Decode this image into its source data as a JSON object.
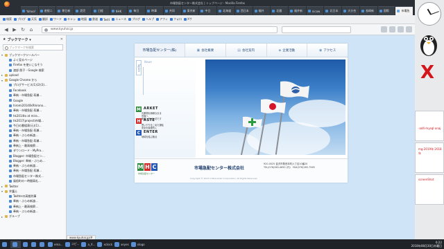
{
  "window": {
    "title": "市場急配センター株式会社 | トップページ - Mozilla Firefox"
  },
  "tabs": [
    {
      "label": "Yahoo!"
    },
    {
      "label": "産経ニ"
    },
    {
      "label": "朝日新"
    },
    {
      "label": "読売"
    },
    {
      "label": "日経"
    },
    {
      "label": "NHK"
    },
    {
      "label": "毎日"
    },
    {
      "label": "時事"
    },
    {
      "label": "共同"
    },
    {
      "label": "東京新"
    },
    {
      "label": "中日"
    },
    {
      "label": "北海道"
    },
    {
      "label": "西日本"
    },
    {
      "label": "福井"
    },
    {
      "label": "北國"
    },
    {
      "label": "福井新"
    },
    {
      "label": "nicow"
    },
    {
      "label": "北日本"
    },
    {
      "label": "大分合"
    },
    {
      "label": "長崎新"
    },
    {
      "label": "国際"
    },
    {
      "label": "市場急"
    }
  ],
  "active_tab_index": 21,
  "bookmarks_bar": [
    "検索",
    "ブログ",
    "天気",
    "翻訳",
    "ワード",
    "キャッ",
    "地図",
    "鉄道",
    "Twitt",
    "ニュース",
    "ブログ",
    "ヘルプ",
    "アフィ",
    "フォロ",
    "Xサ"
  ],
  "navbar": {
    "url": "www.kyuhai.jp",
    "back_icon": "back-arrow-icon",
    "forward_icon": "forward-arrow-icon",
    "reload_icon": "reload-icon",
    "home_icon": "home-icon"
  },
  "sidebar": {
    "title": "ブックマーク ▾",
    "close": "✕",
    "search_placeholder": "ブックマークを検索",
    "items": [
      {
        "indent": 0,
        "twisty": "▾",
        "folder": true,
        "label": "ブックマークツールバー"
      },
      {
        "indent": 1,
        "twisty": "",
        "folder": false,
        "label": "よく見るページ"
      },
      {
        "indent": 1,
        "twisty": "",
        "folder": false,
        "label": "Firefox を使いこなそう"
      },
      {
        "indent": 1,
        "twisty": "",
        "folder": false,
        "label": "渡部 朋子 - Google 検索"
      },
      {
        "indent": 0,
        "twisty": "▸",
        "folder": true,
        "label": "upload"
      },
      {
        "indent": 0,
        "twisty": "▾",
        "folder": true,
        "label": "Google Chrome から"
      },
      {
        "indent": 1,
        "twisty": "",
        "folder": false,
        "label": "プログサービス(1)(2)(3)..."
      },
      {
        "indent": 1,
        "twisty": "",
        "folder": false,
        "label": "Facebook"
      },
      {
        "indent": 1,
        "twisty": "",
        "folder": false,
        "label": "奉納・市場急配 寿瀬..."
      },
      {
        "indent": 1,
        "twisty": "",
        "folder": false,
        "label": "Google"
      },
      {
        "indent": 1,
        "twisty": "",
        "folder": false,
        "label": "hiromi20140kRhirono..."
      },
      {
        "indent": 1,
        "twisty": "",
        "folder": false,
        "label": "奉納・市場急配 寿瀬..."
      },
      {
        "indent": 1,
        "twisty": "",
        "folder": false,
        "label": "hk2014to at mira..."
      },
      {
        "indent": 1,
        "twisty": "",
        "folder": false,
        "label": "hk2017(project)市場..."
      },
      {
        "indent": 1,
        "twisty": "",
        "folder": false,
        "label": "今日の番組表(元)(1)..."
      },
      {
        "indent": 1,
        "twisty": "",
        "folder": false,
        "label": "奉納・市場急配 寿瀬..."
      },
      {
        "indent": 1,
        "twisty": "",
        "folder": false,
        "label": "奉納・ぶらめ新渡..."
      },
      {
        "indent": 1,
        "twisty": "",
        "folder": false,
        "label": "奉納・市場急配 寿瀬..."
      },
      {
        "indent": 1,
        "twisty": "",
        "folder": false,
        "label": "奉納上・最高検察..."
      },
      {
        "indent": 1,
        "twisty": "",
        "folder": false,
        "label": "ダウンロード - MyPro..."
      },
      {
        "indent": 1,
        "twisty": "",
        "folder": false,
        "label": "Blogger: 市場急配セン..."
      },
      {
        "indent": 1,
        "twisty": "",
        "folder": false,
        "label": "Blogger: 奉納・ぶらめ..."
      },
      {
        "indent": 1,
        "twisty": "",
        "folder": false,
        "label": "奉納・ぶらめ新渡..."
      },
      {
        "indent": 1,
        "twisty": "",
        "folder": false,
        "label": "奉納・市場急配 寿瀬..."
      },
      {
        "indent": 1,
        "twisty": "",
        "folder": false,
        "label": "市場急配センター株式..."
      },
      {
        "indent": 1,
        "twisty": "",
        "folder": false,
        "label": "風俗町の一時間高札..."
      },
      {
        "indent": 0,
        "twisty": "▸",
        "folder": true,
        "label": "Twitter"
      },
      {
        "indent": 0,
        "twisty": "▾",
        "folder": true,
        "label": "弁護士"
      },
      {
        "indent": 1,
        "twisty": "",
        "folder": false,
        "label": "Twitterの高裁判事"
      },
      {
        "indent": 1,
        "twisty": "",
        "folder": false,
        "label": "奉納・ぶらめ新渡..."
      },
      {
        "indent": 1,
        "twisty": "",
        "folder": false,
        "label": "奉納上・最高検察..."
      },
      {
        "indent": 1,
        "twisty": "",
        "folder": false,
        "label": "奉納・ぶらめ新渡..."
      },
      {
        "indent": 0,
        "twisty": "▸",
        "folder": true,
        "label": "グループ"
      }
    ]
  },
  "site": {
    "logo": "市場急配センター(株)",
    "nav": [
      {
        "label": "会社概要",
        "icon": "building-icon"
      },
      {
        "label": "会社案内",
        "icon": "document-icon"
      },
      {
        "label": "企業活動",
        "icon": "handshake-icon"
      },
      {
        "label": "アクセス",
        "icon": "map-icon"
      }
    ],
    "topics_label": "Topics",
    "news_label": "News",
    "mhc": [
      {
        "letter": "M",
        "word": "ARKET",
        "color": "#2e8b3e",
        "desc": "青果物を新鮮なまま\n市場へ\n鮮度！日が大切です"
      },
      {
        "letter": "H",
        "word": "ASTE",
        "color": "#d42a2a",
        "desc": "思いやりをこめた運転\n安全を最優先に"
      },
      {
        "letter": "C",
        "word": "ENTER",
        "color": "#2458b8",
        "desc": "地域を結ぶ拠点"
      }
    ],
    "footer": {
      "logo_letters": [
        "M",
        "H",
        "C"
      ],
      "logo_colors": [
        "#2e8b3e",
        "#d42a2a",
        "#2458b8"
      ],
      "logo_sub": "市場急配センター",
      "company": "市場急配センター株式会社",
      "address": "920-0025 金沢市駅西本町六丁目10番20",
      "tel": "TEL(076)260-4650 (代)　FAX(076)265-7565",
      "copyright": "Copyright © 2013 Ichibacenter Corporation. All Rights Reserved."
    }
  },
  "statusbar": {
    "text": "www.kyuhai.jp/#"
  },
  "taskbar": {
    "items": [
      {
        "label": ""
      },
      {
        "label": ""
      },
      {
        "label": ""
      },
      {
        "label": ""
      },
      {
        "label": ""
      },
      {
        "label": "ema..."
      },
      {
        "label": "コピ..."
      },
      {
        "label": "a_X..."
      },
      {
        "label": "xclock"
      },
      {
        "label": "xeyes"
      },
      {
        "label": "xlogo"
      }
    ],
    "time": "6:22",
    "date": "2018年08月30日木曜日"
  },
  "desktop_right": {
    "lines_1": [
      "-ad4-mysql-anaj"
    ],
    "lines_2": [
      "mg-2019年:2018年"
    ],
    "lines_3": [
      "screenShot"
    ]
  }
}
